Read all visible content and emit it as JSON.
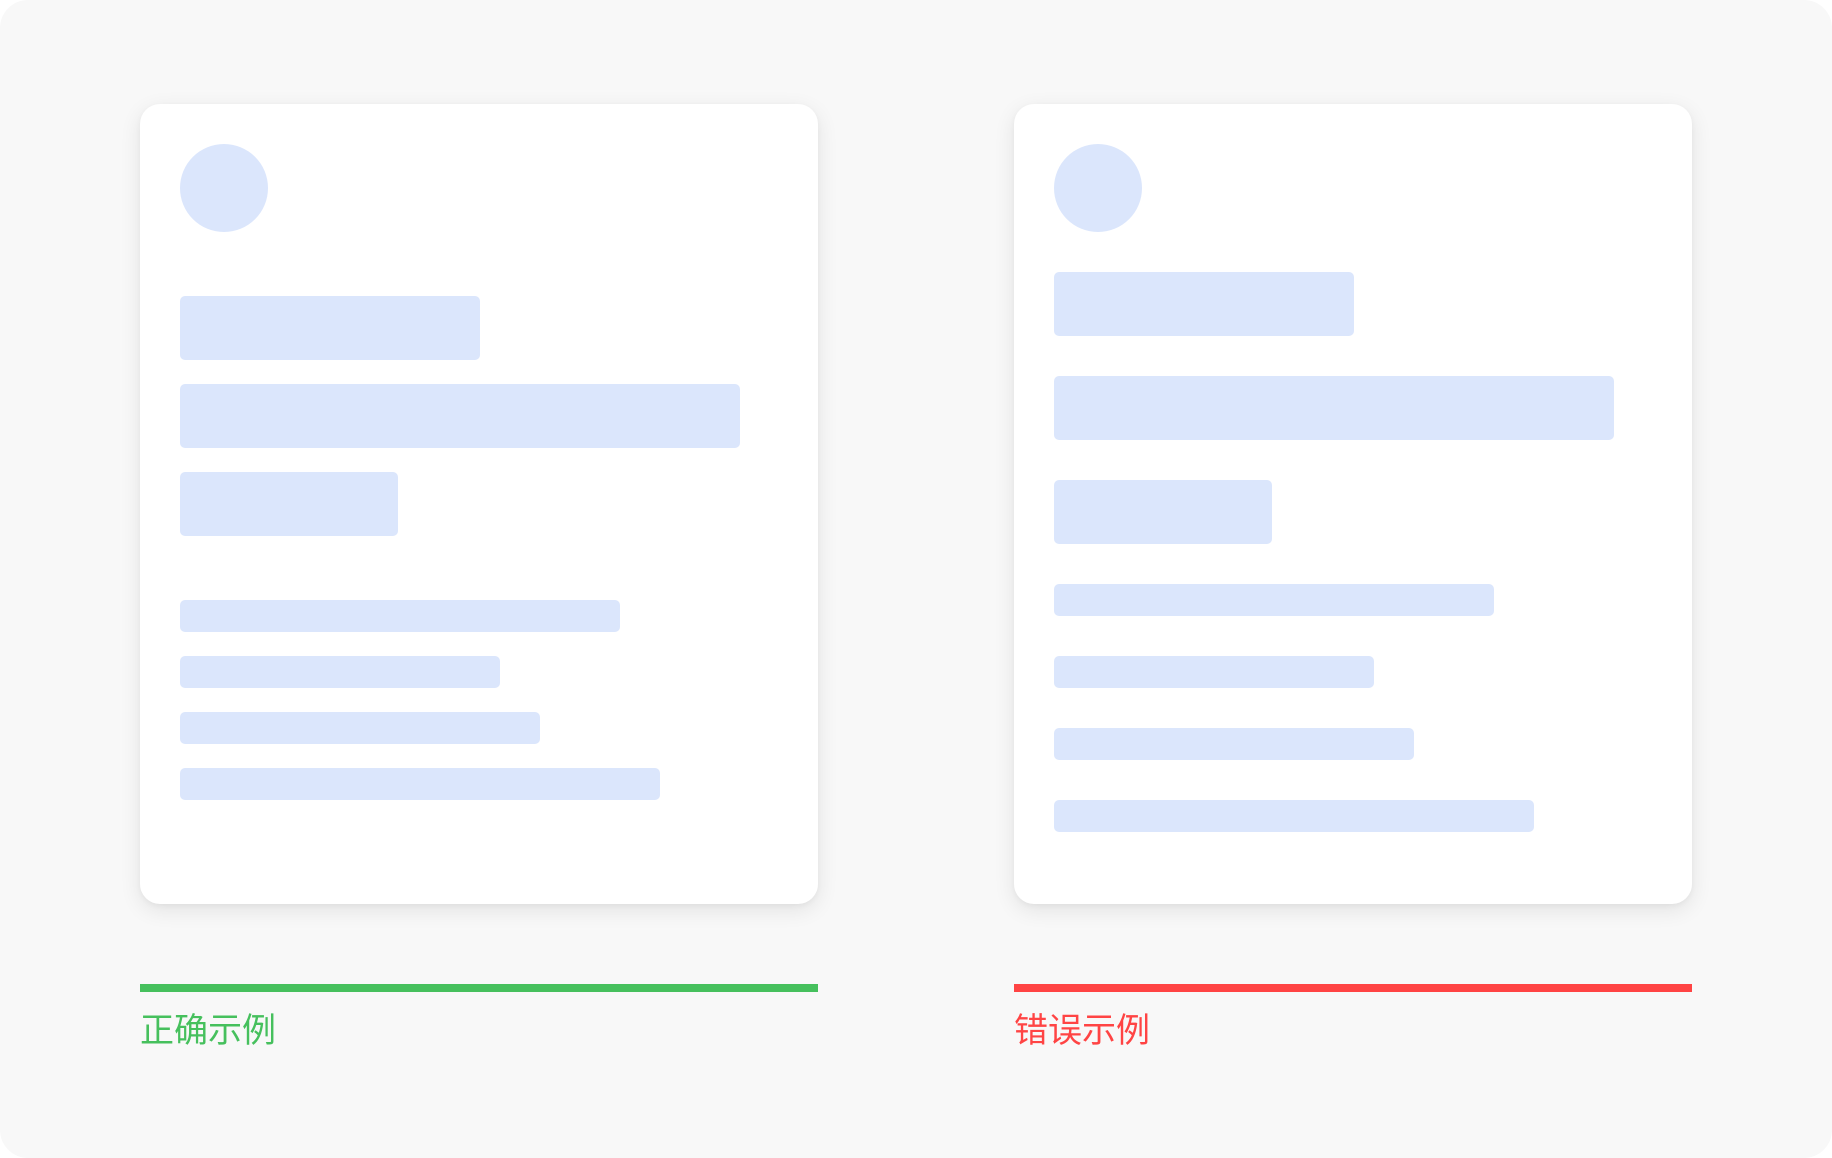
{
  "examples": {
    "correct": {
      "label": "正确示例",
      "accent_color": "#46c05d"
    },
    "wrong": {
      "label": "错误示例",
      "accent_color": "#ff4444"
    }
  },
  "colors": {
    "background": "#f8f8f8",
    "card": "#ffffff",
    "placeholder": "#dbe6fc"
  }
}
